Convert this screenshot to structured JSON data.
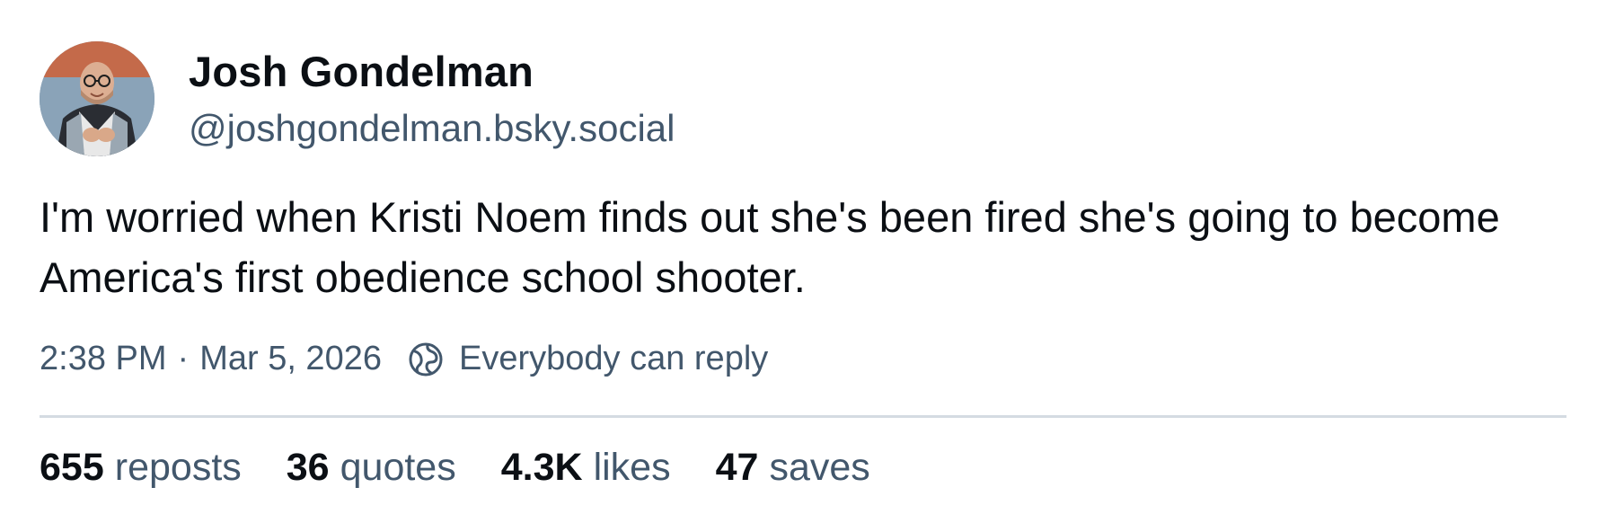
{
  "author": {
    "display_name": "Josh Gondelman",
    "handle": "@joshgondelman.bsky.social",
    "avatar_icon": "avatar-photo"
  },
  "post": {
    "text": "I'm worried when Kristi Noem finds out she's been fired she's going to become America's first obedience school shooter."
  },
  "meta": {
    "time": "2:38 PM",
    "separator": "·",
    "date": "Mar 5, 2026",
    "reply_icon": "globe-icon",
    "reply_setting": "Everybody can reply"
  },
  "stats": {
    "reposts": {
      "count": "655",
      "label": "reposts"
    },
    "quotes": {
      "count": "36",
      "label": "quotes"
    },
    "likes": {
      "count": "4.3K",
      "label": "likes"
    },
    "saves": {
      "count": "47",
      "label": "saves"
    }
  },
  "colors": {
    "text_primary": "#0b0f14",
    "text_secondary": "#42576c",
    "divider": "#d4dbe2",
    "background": "#ffffff"
  }
}
